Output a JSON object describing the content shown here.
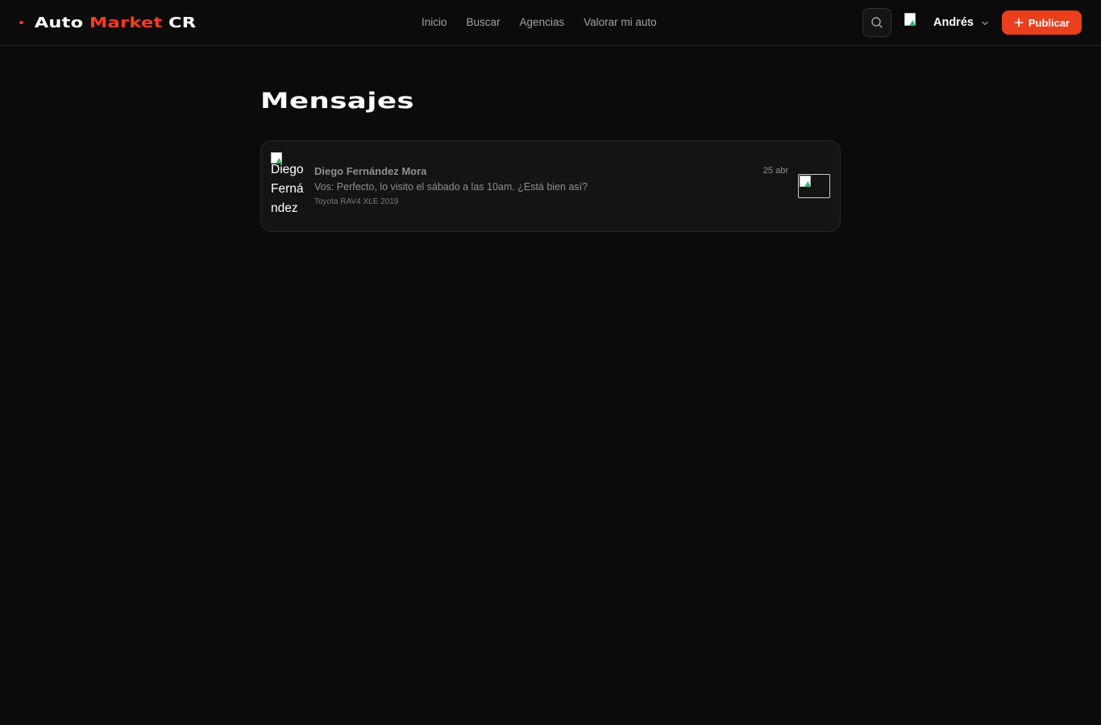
{
  "brand": {
    "word1": "Auto",
    "word2": "Market",
    "word3": "CR",
    "accent_color": "#ff3b1f"
  },
  "nav": {
    "items": [
      {
        "label": "Inicio"
      },
      {
        "label": "Buscar"
      },
      {
        "label": "Agencias"
      },
      {
        "label": "Valorar mi auto"
      }
    ]
  },
  "header": {
    "search_icon": "search-icon",
    "user_name": "Andrés",
    "user_menu_icon": "chevron-down-icon",
    "publish_label": "Publicar",
    "publish_icon": "plus-icon",
    "publish_color": "#e8401c"
  },
  "main": {
    "title": "Mensajes",
    "threads": [
      {
        "avatar_alt": "Diego Fernández Mora",
        "name": "Diego Fernández Mora",
        "date": "25 abr",
        "last_message": "Vos: Perfecto, lo visito el sábado a las 10am. ¿Está bien así?",
        "vehicle": "Toyota RAV4 XLE 2019"
      }
    ]
  }
}
